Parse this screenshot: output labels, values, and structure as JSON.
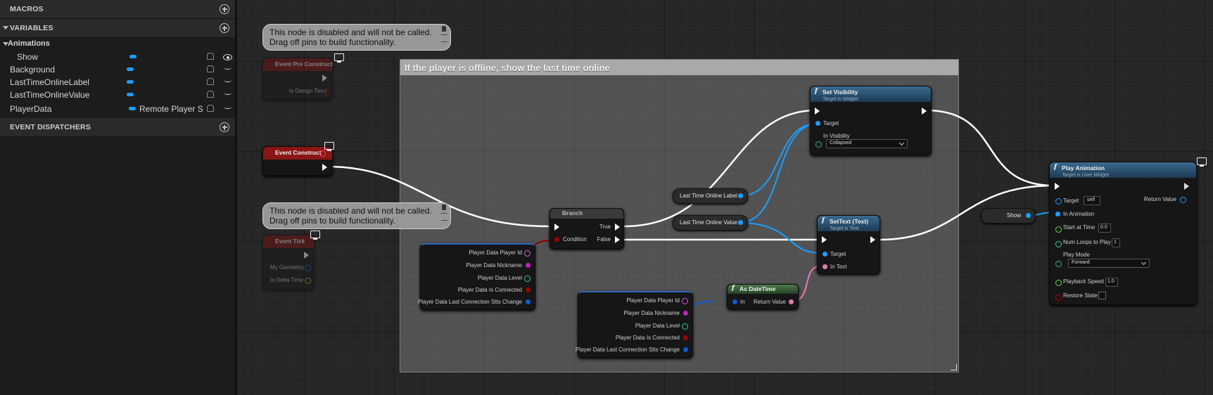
{
  "panel": {
    "macros": "MACROS",
    "variables": "VARIABLES",
    "animations_group": "Animations",
    "items": [
      {
        "name": "Show",
        "type": ""
      },
      {
        "name": "Background",
        "type": ""
      },
      {
        "name": "LastTimeOnlineLabel",
        "type": ""
      },
      {
        "name": "LastTimeOnlineValue",
        "type": ""
      },
      {
        "name": "PlayerData",
        "type": "Remote Player S"
      }
    ],
    "event_dispatchers": "EVENT DISPATCHERS"
  },
  "graph": {
    "comment_title": "If the player is offline, show the last time online",
    "disabled_note": "This node is disabled and will not be called.",
    "disabled_note2": "Drag off pins to build functionality.",
    "pre_construct": {
      "title": "Event Pre Construct",
      "pin": "Is Design Time"
    },
    "construct": {
      "title": "Event Construct"
    },
    "tick": {
      "title": "Event Tick",
      "pins": [
        "My Geometry",
        "In Delta Time"
      ]
    },
    "branch": {
      "title": "Branch",
      "true": "True",
      "false": "False",
      "condition": "Condition"
    },
    "player_data_a": [
      "Player Data Player Id",
      "Player Data Nickname",
      "Player Data Level",
      "Player Data Is Connected",
      "Player Data Last Connection Stts Change"
    ],
    "player_data_b": [
      "Player Data Player Id",
      "Player Data Nickname",
      "Player Data Level",
      "Player Data Is Connected",
      "Player Data Last Connection Stts Change"
    ],
    "label_var": "Last Time Online Label",
    "value_var": "Last Time Online Value",
    "show_var": "Show",
    "set_visibility": {
      "title": "Set Visibility",
      "sub": "Target is Widget",
      "target": "Target",
      "in_visibility": "In Visibility",
      "value": "Collapsed"
    },
    "set_text": {
      "title": "SetText (Text)",
      "sub": "Target is Text",
      "target": "Target",
      "in_text": "In Text"
    },
    "as_datetime": {
      "title": "As DateTime",
      "in": "In",
      "ret": "Return Value"
    },
    "play_anim": {
      "title": "Play Animation",
      "sub": "Target is User Widget",
      "target": "Target",
      "target_val": "self",
      "ret": "Return Value",
      "in_anim": "In Animation",
      "start": "Start at Time",
      "start_val": "0.0",
      "loops": "Num Loops to Play",
      "loops_val": "1",
      "mode": "Play Mode",
      "mode_val": "Forward",
      "speed": "Playback Speed",
      "speed_val": "1.0",
      "restore": "Restore State"
    }
  },
  "colors": {
    "exec": "#ffffff",
    "object": "#1aa0ff",
    "bool": "#8c0000",
    "text": "#e87ab3",
    "struct": "#0b5ad6"
  }
}
